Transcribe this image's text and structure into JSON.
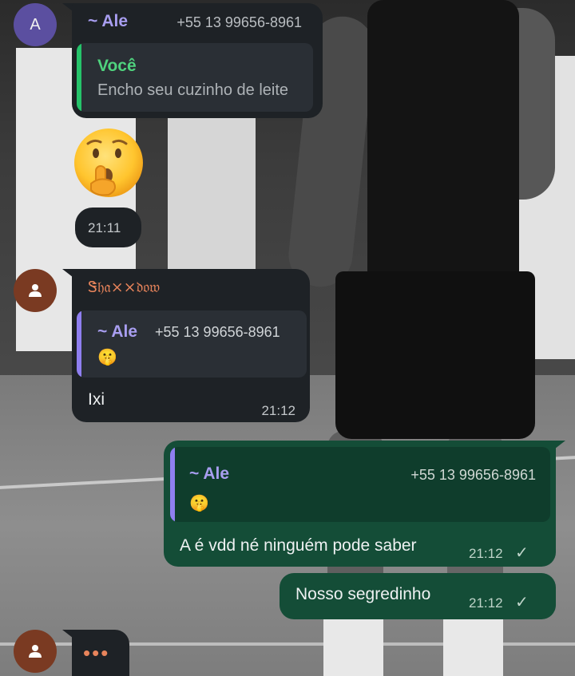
{
  "colors": {
    "incoming_bubble": "#1e2226",
    "outgoing_bubble": "#144d37",
    "quote_bar_you": "#25c36a",
    "quote_bar_ale": "#8f7ff0",
    "sender_ale": "#a89ef0",
    "sender_shadow": "#e8845b",
    "you_label": "#4fd37e"
  },
  "messages": {
    "m1": {
      "avatar_letter": "A",
      "sender": "~ Ale",
      "phone": "+55 13 99656-8961",
      "quote_author": "Você",
      "quote_text": "Encho seu cuzinho de leite"
    },
    "m2": {
      "sticker_icon": "shushing-face-icon",
      "time": "21:11"
    },
    "m3": {
      "sender": "Ꮥ𝔥𝔞××𝔡𝔬𝔴",
      "quote_author": "~ Ale",
      "quote_phone": "+55 13 99656-8961",
      "quote_emoji": "🤫",
      "text": "Ixi",
      "time": "21:12"
    },
    "m4": {
      "quote_author": "~ Ale",
      "quote_phone": "+55 13 99656-8961",
      "quote_emoji": "🤫",
      "text": "A é vdd né ninguém pode saber",
      "time": "21:12",
      "status": "✓"
    },
    "m5": {
      "text": "Nosso segredinho",
      "time": "21:12",
      "status": "✓"
    },
    "typing": {
      "dots": "•••"
    }
  }
}
